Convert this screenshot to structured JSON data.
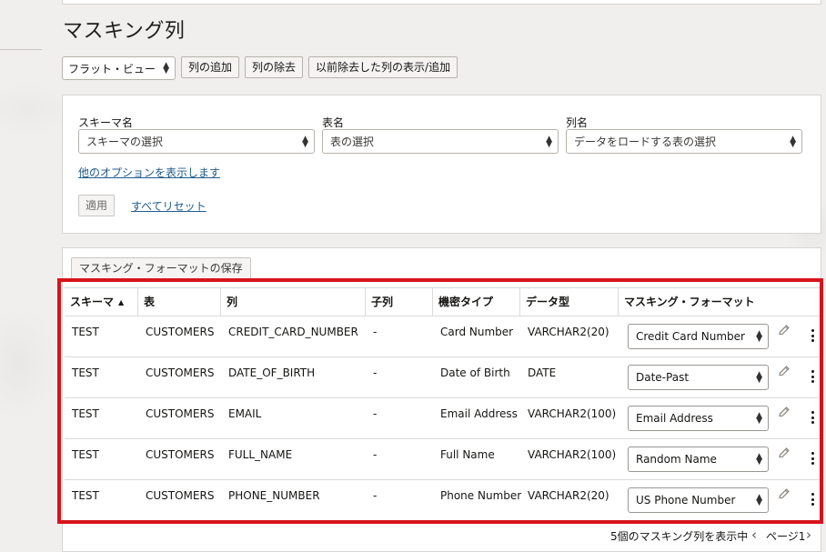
{
  "page": {
    "title": "マスキング列"
  },
  "toolbar": {
    "view_select": "フラット・ビュー",
    "add_column": "列の追加",
    "remove_column": "列の除去",
    "show_removed": "以前除去した列の表示/追加"
  },
  "filters": {
    "schema": {
      "label": "スキーマ名",
      "placeholder": "スキーマの選択"
    },
    "table": {
      "label": "表名",
      "placeholder": "表の選択"
    },
    "column": {
      "label": "列名",
      "placeholder": "データをロードする表の選択"
    },
    "more_options": "他のオプションを表示します",
    "apply": "適用",
    "reset_all": "すべてリセット"
  },
  "table": {
    "save_formats": "マスキング・フォーマットの保存",
    "headers": [
      "スキーマ",
      "表",
      "列",
      "子列",
      "機密タイプ",
      "データ型",
      "マスキング・フォーマット"
    ],
    "sorted_column": "スキーマ",
    "sort_direction": "ascending",
    "rows": [
      {
        "schema": "TEST",
        "table": "CUSTOMERS",
        "column": "CREDIT_CARD_NUMBER",
        "child": "-",
        "sensitive_type": "Card Number",
        "data_type": "VARCHAR2(20)",
        "format": "Credit Card Number"
      },
      {
        "schema": "TEST",
        "table": "CUSTOMERS",
        "column": "DATE_OF_BIRTH",
        "child": "-",
        "sensitive_type": "Date of Birth",
        "data_type": "DATE",
        "format": "Date-Past"
      },
      {
        "schema": "TEST",
        "table": "CUSTOMERS",
        "column": "EMAIL",
        "child": "-",
        "sensitive_type": "Email Address",
        "data_type": "VARCHAR2(100)",
        "format": "Email Address"
      },
      {
        "schema": "TEST",
        "table": "CUSTOMERS",
        "column": "FULL_NAME",
        "child": "-",
        "sensitive_type": "Full Name",
        "data_type": "VARCHAR2(100)",
        "format": "Random Name"
      },
      {
        "schema": "TEST",
        "table": "CUSTOMERS",
        "column": "PHONE_NUMBER",
        "child": "-",
        "sensitive_type": "Phone Number",
        "data_type": "VARCHAR2(20)",
        "format": "US Phone Number"
      }
    ]
  },
  "footer": {
    "summary": "5個のマスキング列を表示中",
    "page_label": "ページ1"
  },
  "icons": {
    "edit": "pencil-icon",
    "actions": "kebab-menu-icon",
    "prev": "chevron-left-icon",
    "next": "chevron-right-icon"
  },
  "colors": {
    "highlight": "#d7141b",
    "link": "#1e5b8c"
  }
}
